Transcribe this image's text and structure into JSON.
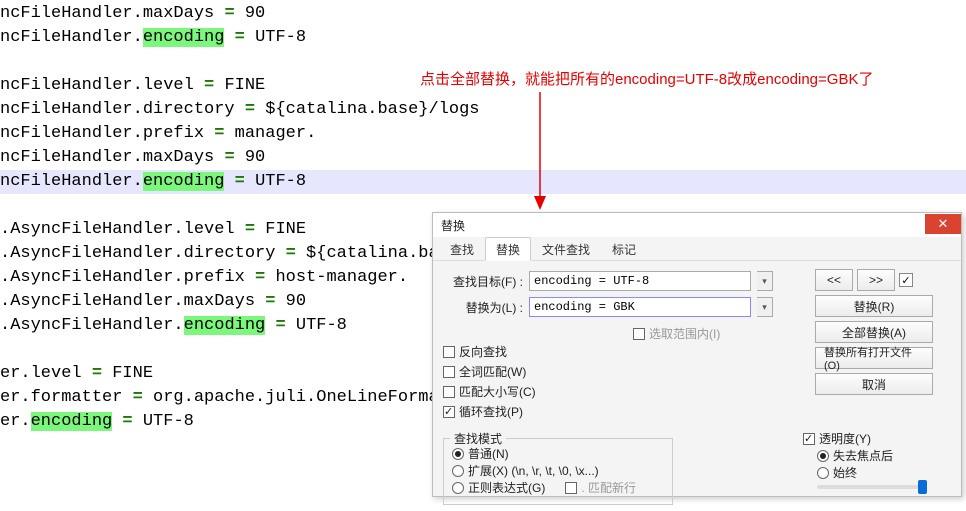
{
  "annotation": "点击全部替换，就能把所有的encoding=UTF-8改成encoding=GBK了",
  "editor": {
    "lines": [
      {
        "pre": "ncFileHandler.maxDays ",
        "eq": "=",
        "post": " 90",
        "hl": ""
      },
      {
        "pre": "ncFileHandler.",
        "hl": "encoding",
        "eq": " = ",
        "post": "UTF-8"
      },
      {
        "blank": true
      },
      {
        "pre": "ncFileHandler.level ",
        "eq": "=",
        "post": " FINE",
        "hl": ""
      },
      {
        "pre": "ncFileHandler.directory ",
        "eq": "=",
        "post": " ${catalina.base}/logs",
        "hl": ""
      },
      {
        "pre": "ncFileHandler.prefix ",
        "eq": "=",
        "post": " manager.",
        "hl": ""
      },
      {
        "pre": "ncFileHandler.maxDays ",
        "eq": "=",
        "post": " 90",
        "hl": ""
      },
      {
        "pre": "ncFileHandler.",
        "hl": "encoding",
        "eq": " = ",
        "post": "UTF-8",
        "current": true
      },
      {
        "blank": true
      },
      {
        "pre": ".AsyncFileHandler.level ",
        "eq": "=",
        "post": " FINE",
        "hl": ""
      },
      {
        "pre": ".AsyncFileHandler.directory ",
        "eq": "=",
        "post": " ${catalina.base}/log",
        "hl": ""
      },
      {
        "pre": ".AsyncFileHandler.prefix ",
        "eq": "=",
        "post": " host-manager.",
        "hl": ""
      },
      {
        "pre": ".AsyncFileHandler.maxDays ",
        "eq": "=",
        "post": " 90",
        "hl": ""
      },
      {
        "pre": ".AsyncFileHandler.",
        "hl": "encoding",
        "eq": " = ",
        "post": "UTF-8"
      },
      {
        "blank": true
      },
      {
        "pre": "er.level ",
        "eq": "=",
        "post": " FINE",
        "hl": ""
      },
      {
        "pre": "er.formatter ",
        "eq": "=",
        "post": " org.apache.juli.OneLineFormatter",
        "hl": ""
      },
      {
        "pre": "er.",
        "hl": "encoding",
        "eq": " = ",
        "post": "UTF-8"
      }
    ]
  },
  "dialog": {
    "title": "替换",
    "tabs": {
      "find": "查找",
      "replace": "替换",
      "findInFiles": "文件查找",
      "mark": "标记"
    },
    "activeTab": "replace",
    "labels": {
      "findWhat": "查找目标(F) :",
      "replaceWith": "替换为(L) :",
      "inSelection": "选取范围内(I)"
    },
    "values": {
      "findWhat": "encoding = UTF-8",
      "replaceWith": "encoding = GBK"
    },
    "buttons": {
      "prev": "<<",
      "next": ">>",
      "replace": "替换(R)",
      "replaceAll": "全部替换(A)",
      "replaceAllOpen": "替换所有打开文件(O)",
      "cancel": "取消"
    },
    "options": {
      "backward": "反向查找",
      "wholeWord": "全词匹配(W)",
      "matchCase": "匹配大小写(C)",
      "wrap": "循环查找(P)",
      "wrapChecked": true
    },
    "searchMode": {
      "title": "查找模式",
      "normal": "普通(N)",
      "extended": "扩展(X) (\\n, \\r, \\t, \\0, \\x...)",
      "regex": "正则表达式(G)",
      "matchNewline": ". 匹配新行",
      "selected": "normal"
    },
    "transparency": {
      "title": "透明度(Y)",
      "enabled": true,
      "onLoseFocus": "失去焦点后",
      "always": "始终",
      "selected": "onLoseFocus"
    }
  }
}
